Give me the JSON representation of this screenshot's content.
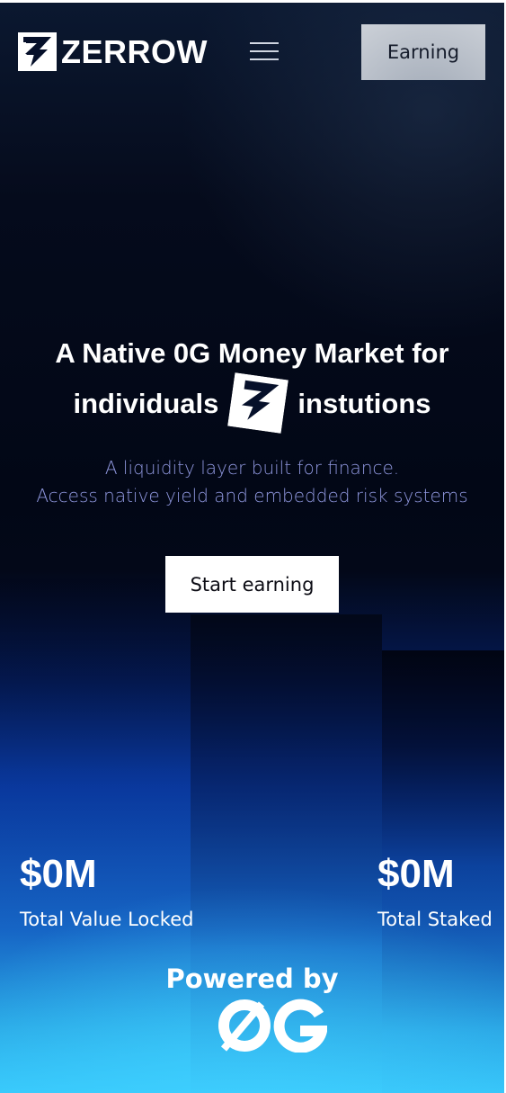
{
  "header": {
    "brand": "ZERROW",
    "earning_button": "Earning"
  },
  "hero": {
    "title_line1": "A Native 0G Money Market for",
    "title_line2_left": "individuals",
    "title_line2_right": "instutions",
    "subtitle_line1": "A liquidity layer built for finance.",
    "subtitle_line2": "Access native yield and embedded risk systems",
    "cta": "Start earning"
  },
  "stats": [
    {
      "value": "$0M",
      "label": "Total Value Locked"
    },
    {
      "value": "$0M",
      "label": "Total Staked"
    }
  ],
  "footer": {
    "powered_by": "Powered by"
  },
  "icons": {
    "logo": "zerrow-logo-icon",
    "menu": "hamburger-menu-icon",
    "partner": "0g-logo-icon"
  }
}
